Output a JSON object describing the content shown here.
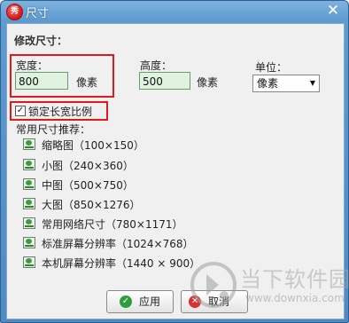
{
  "window": {
    "title": "尺寸",
    "app_icon_text": "秀",
    "close_glyph": "✕"
  },
  "modify_size": {
    "heading": "修改尺寸：",
    "width_label": "宽度：",
    "width_value": "800",
    "width_unit": "像素",
    "height_label": "高度：",
    "height_value": "500",
    "height_unit": "像素",
    "unit_label": "单位：",
    "unit_selected": "像素"
  },
  "lock_ratio": {
    "label": "锁定长宽比例",
    "checked": true
  },
  "presets": {
    "heading": "常用尺寸推荐：",
    "items": [
      {
        "label": "缩略图（100×150）",
        "icon": "image-icon"
      },
      {
        "label": "小图（240×360）",
        "icon": "image-icon"
      },
      {
        "label": "中图（500×750）",
        "icon": "image-icon"
      },
      {
        "label": "大图（850×1276）",
        "icon": "image-icon"
      },
      {
        "label": "常用网络尺寸（780×1171）",
        "icon": "image-icon"
      },
      {
        "label": "标准屏幕分辨率（1024×768）",
        "icon": "image-icon"
      },
      {
        "label": "本机屏幕分辨率（1440 × 900）",
        "icon": "image-icon"
      }
    ]
  },
  "buttons": {
    "apply_label": "应用",
    "cancel_label": "取消"
  },
  "watermark": {
    "text": "当下软件园",
    "url": "www.downxia.com"
  },
  "colors": {
    "title_bar": "#5d9bd0",
    "highlight_box": "#e01a1a",
    "input_bg": "#dff3e0"
  }
}
